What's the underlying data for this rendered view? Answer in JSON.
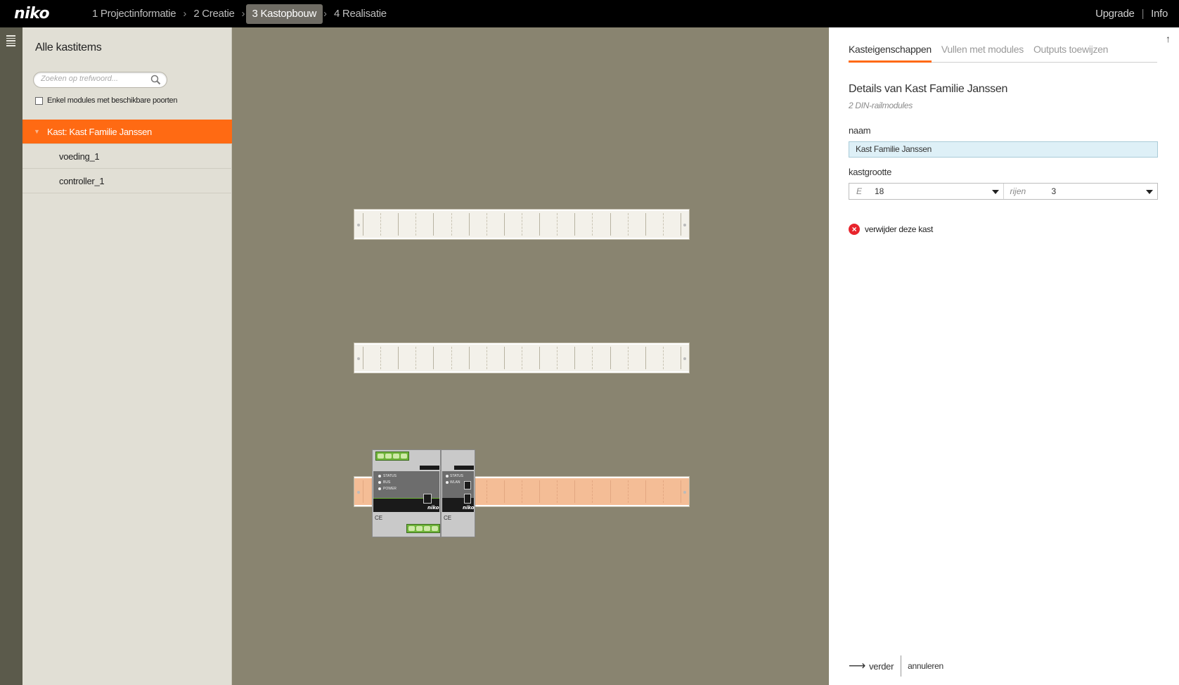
{
  "header": {
    "logo": "niko",
    "steps": [
      {
        "label": "1 Projectinformatie"
      },
      {
        "label": "2 Creatie"
      },
      {
        "label": "3 Kastopbouw"
      },
      {
        "label": "4 Realisatie"
      }
    ],
    "separator": "›",
    "upgrade": "Upgrade",
    "divider": "|",
    "info": "Info"
  },
  "sidebar": {
    "title": "Alle kastitems",
    "search_placeholder": "Zoeken op trefwoord...",
    "filter_label": "Enkel modules met beschikbare poorten",
    "filter_checked": false,
    "tree": {
      "root": "Kast: Kast Familie Janssen",
      "children": [
        "voeding_1",
        "controller_1"
      ]
    }
  },
  "canvas": {
    "rows": 3,
    "module_width_e": 18,
    "modules": [
      {
        "name": "voeding",
        "brand": "niko",
        "status_labels": [
          "STATUS",
          "BUS",
          "POWER"
        ]
      },
      {
        "name": "controller",
        "brand": "niko",
        "status_labels": [
          "STATUS",
          "WLAN"
        ]
      }
    ]
  },
  "panel": {
    "tabs": [
      {
        "label": "Kasteigenschappen",
        "active": true
      },
      {
        "label": "Vullen met modules",
        "active": false
      },
      {
        "label": "Outputs toewijzen",
        "active": false
      }
    ],
    "details_title": "Details van Kast Familie Janssen",
    "details_subtitle": "2 DIN-railmodules",
    "name_label": "naam",
    "name_value": "Kast Familie Janssen",
    "size_label": "kastgrootte",
    "size_e_prefix": "E",
    "size_e_value": "18",
    "size_rows_prefix": "rijen",
    "size_rows_value": "3",
    "delete_label": "verwijder deze kast",
    "next_label": "verder",
    "cancel_label": "annuleren"
  },
  "colors": {
    "accent": "#ff6a13",
    "topbar": "#000000",
    "canvas": "#898470",
    "sidebar": "#e1dfd5",
    "delete": "#e8242c"
  }
}
